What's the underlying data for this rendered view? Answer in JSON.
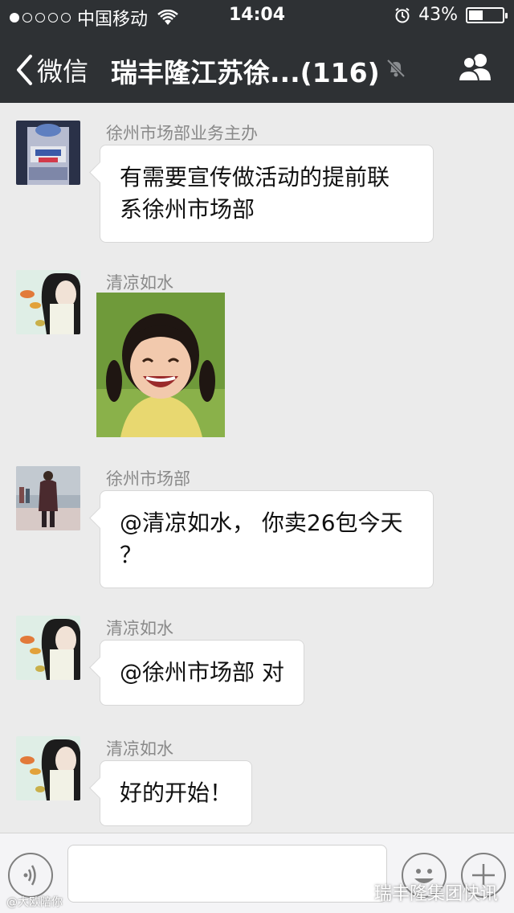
{
  "status_bar": {
    "signal_dots_filled": 1,
    "signal_dots_total": 5,
    "carrier": "中国移动",
    "time": "14:04",
    "battery_percent": "43%",
    "battery_level": 0.43
  },
  "nav": {
    "back_label": "微信",
    "title": "瑞丰隆江苏徐...(116)",
    "mute_icon": "mute-bell-icon",
    "group_icon": "group-members-icon"
  },
  "messages": [
    {
      "sender": "徐州市场部业务主办",
      "type": "text",
      "text_lines": [
        "有需要宣传做活动的提前联",
        "系徐州市场部"
      ]
    },
    {
      "sender": "清凉如水",
      "type": "image",
      "image_desc": "laughing-girl-photo"
    },
    {
      "sender": "徐州市场部",
      "type": "text",
      "text_lines": [
        "@清凉如水， 你卖26包今天",
        "？"
      ]
    },
    {
      "sender": "清凉如水",
      "type": "text",
      "text_lines": [
        "@徐州市场部 对"
      ]
    },
    {
      "sender": "清凉如水",
      "type": "text",
      "text_lines": [
        "好的开始！"
      ]
    }
  ],
  "input_bar": {
    "voice_icon": "voice-icon",
    "emoji_icon": "emoji-icon",
    "plus_icon": "plus-icon"
  },
  "watermarks": {
    "left": "@大欧陪你",
    "right": "瑞丰隆集团快讯"
  },
  "colors": {
    "nav_bg": "#2e3134",
    "chat_bg": "#ebebeb",
    "bubble_bg": "#ffffff",
    "sender_text": "#8a8a8a"
  }
}
